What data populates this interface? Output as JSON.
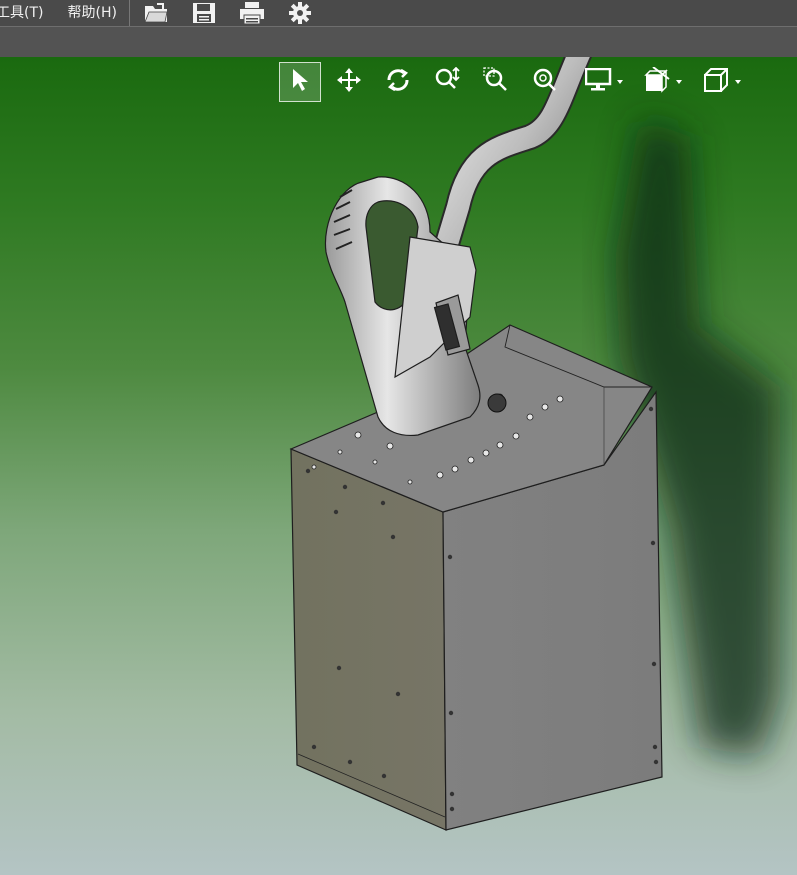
{
  "menubar": {
    "items": [
      {
        "label": "工具(T)"
      },
      {
        "label": "帮助(H)"
      }
    ],
    "icons": [
      "open-file-icon",
      "save-icon",
      "print-icon",
      "settings-gear-icon"
    ]
  },
  "viewport": {
    "background_top": "#1a6a0f",
    "background_bottom": "#b4c4c4",
    "toolbar": [
      {
        "name": "select-tool",
        "icon": "arrow-pointer-icon",
        "active": true
      },
      {
        "name": "pan-tool",
        "icon": "move-arrows-icon",
        "active": false
      },
      {
        "name": "rotate-tool",
        "icon": "rotate-icon",
        "active": false
      },
      {
        "name": "zoom-tool",
        "icon": "zoom-icon",
        "active": false
      },
      {
        "name": "zoom-window-tool",
        "icon": "zoom-window-icon",
        "active": false
      },
      {
        "name": "zoom-fit-tool",
        "icon": "zoom-fit-icon",
        "active": false
      },
      {
        "name": "display-mode-dropdown",
        "icon": "monitor-icon",
        "active": false
      },
      {
        "name": "section-view-dropdown",
        "icon": "section-box-icon",
        "active": false
      },
      {
        "name": "view-orientation-dropdown",
        "icon": "cube-icon",
        "active": false
      }
    ]
  }
}
